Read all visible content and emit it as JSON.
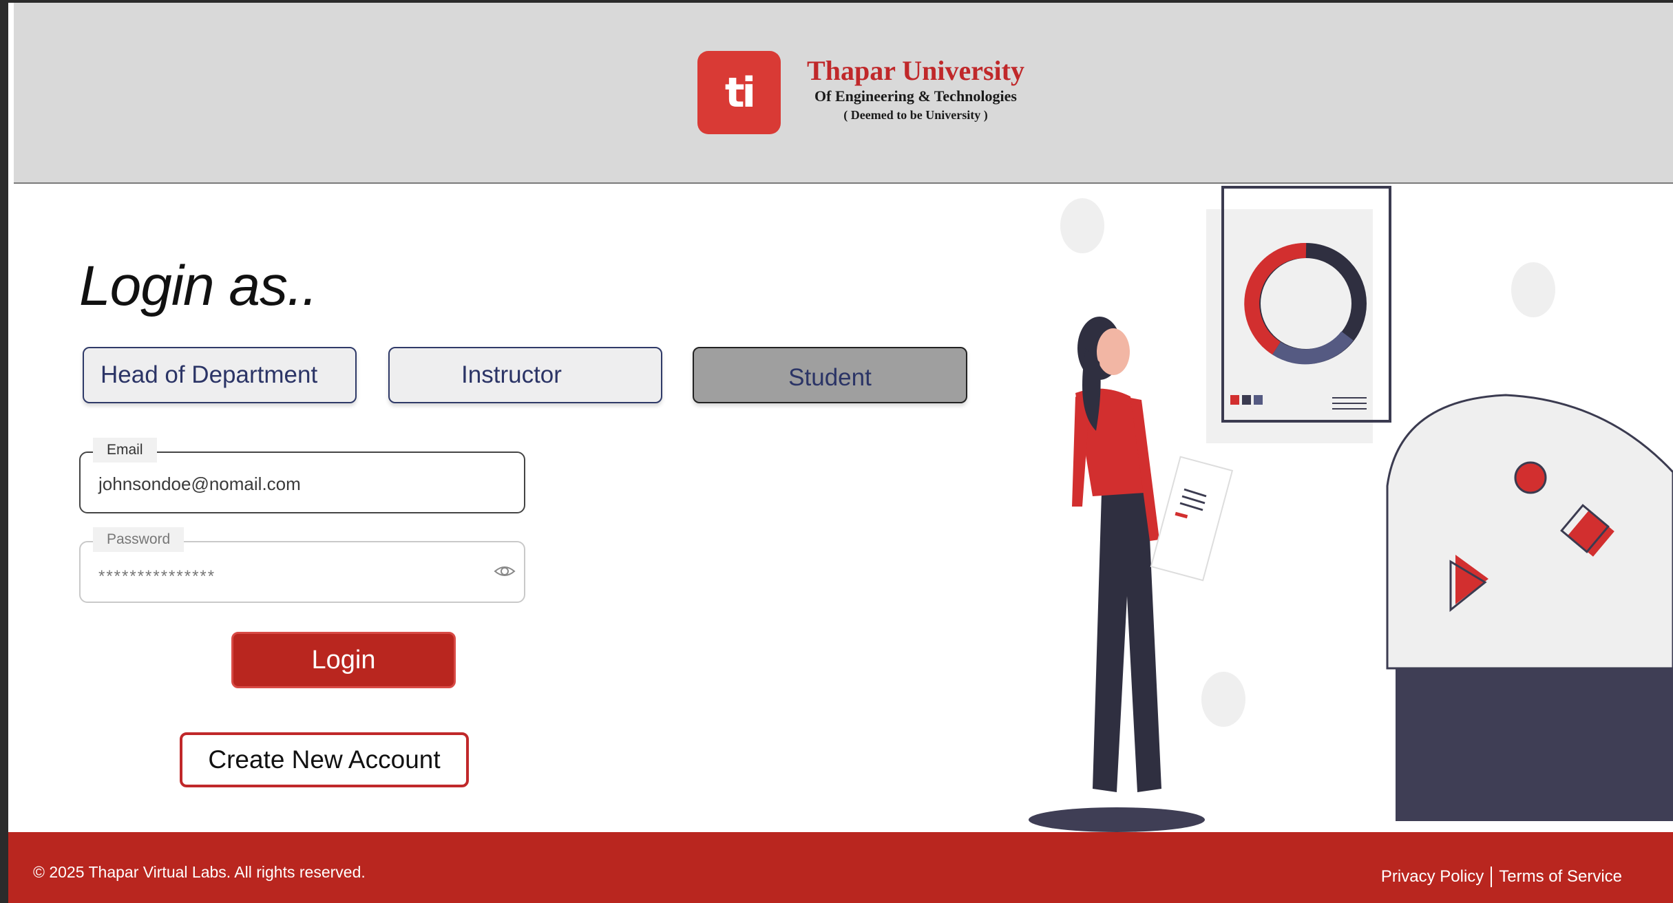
{
  "header": {
    "logo_text": "ti",
    "brand_title": "Thapar University",
    "brand_subtitle": "Of Engineering & Technologies",
    "brand_note": "( Deemed to be University )"
  },
  "login": {
    "title": "Login as..",
    "roles": [
      {
        "label": "Head of Department",
        "selected": false
      },
      {
        "label": "Instructor",
        "selected": false
      },
      {
        "label": "Student",
        "selected": true
      }
    ],
    "email_label": "Email",
    "email_value": "johnsondoe@nomail.com",
    "password_label": "Password",
    "password_value": "***************",
    "login_button": "Login",
    "create_account_button": "Create New Account"
  },
  "footer": {
    "copyright": "© 2025 Thapar Virtual Labs. All rights reserved.",
    "privacy": "Privacy Policy",
    "terms": "Terms of Service"
  },
  "colors": {
    "brand_red": "#b9261f",
    "navy": "#2b3466",
    "header_gray": "#d9d9d9"
  }
}
